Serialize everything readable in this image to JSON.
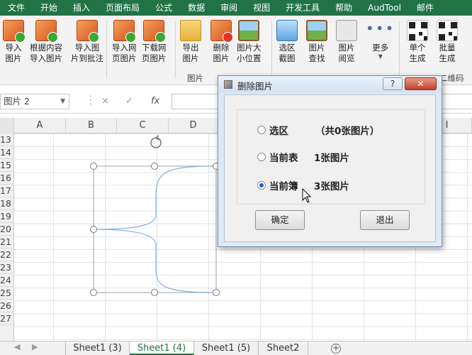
{
  "ribbon_tabs": [
    "文件",
    "开始",
    "插入",
    "页面布局",
    "公式",
    "数据",
    "审阅",
    "视图",
    "开发工具",
    "帮助",
    "AudTool",
    "邮件"
  ],
  "ribbon_buttons": [
    {
      "label": "导入\n图片",
      "icon": "import-picture-icon"
    },
    {
      "label": "根据内容\n导入图片",
      "icon": "import-by-content-icon"
    },
    {
      "label": "导入图\n片到批注",
      "icon": "import-to-comment-icon"
    },
    {
      "label": "导入网\n页图片",
      "icon": "import-web-picture-icon"
    },
    {
      "label": "下载网\n页图片",
      "icon": "download-web-picture-icon"
    },
    {
      "label": "导出\n图片",
      "icon": "export-picture-icon"
    },
    {
      "label": "删除\n图片",
      "icon": "delete-picture-icon"
    },
    {
      "label": "图片大\n小位置",
      "icon": "picture-size-icon"
    },
    {
      "label": "选区\n截图",
      "icon": "screenshot-icon"
    },
    {
      "label": "图片\n查找",
      "icon": "picture-find-icon"
    },
    {
      "label": "图片\n阅览",
      "icon": "picture-view-icon"
    },
    {
      "label": "更多",
      "icon": "more-dots-icon"
    },
    {
      "label": "单个\n生成",
      "icon": "qr-single-icon"
    },
    {
      "label": "批量\n生成",
      "icon": "qr-batch-icon"
    }
  ],
  "ribbon_groups": {
    "picture": "图片",
    "qrcode": "二维码"
  },
  "name_box": "图片 2",
  "formula_icons": {
    "cancel": "×",
    "enter": "✓",
    "fx": "fx"
  },
  "columns": [
    "A",
    "B",
    "C",
    "D",
    "I"
  ],
  "rows": [
    "13",
    "14",
    "15",
    "16",
    "17",
    "18",
    "19",
    "20",
    "21",
    "22",
    "23",
    "24",
    "25",
    "26",
    "27"
  ],
  "sheet_tabs": [
    {
      "label": "Sheet1 (3)",
      "active": false
    },
    {
      "label": "Sheet1 (4)",
      "active": true
    },
    {
      "label": "Sheet1 (5)",
      "active": false
    },
    {
      "label": "Sheet2",
      "active": false
    }
  ],
  "dialog": {
    "title": "删除图片",
    "help": "?",
    "close": "✕",
    "options": [
      {
        "label": "选区",
        "info": "（共0张图片）",
        "selected": false
      },
      {
        "label": "当前表",
        "info": "1张图片",
        "selected": false
      },
      {
        "label": "当前簿",
        "info": "3张图片",
        "selected": true
      }
    ],
    "ok": "确定",
    "exit": "退出"
  },
  "colors": {
    "ribbon_green": "#217346",
    "dialog_border": "#6f8db5",
    "shape_line": "#8ab4e0"
  }
}
